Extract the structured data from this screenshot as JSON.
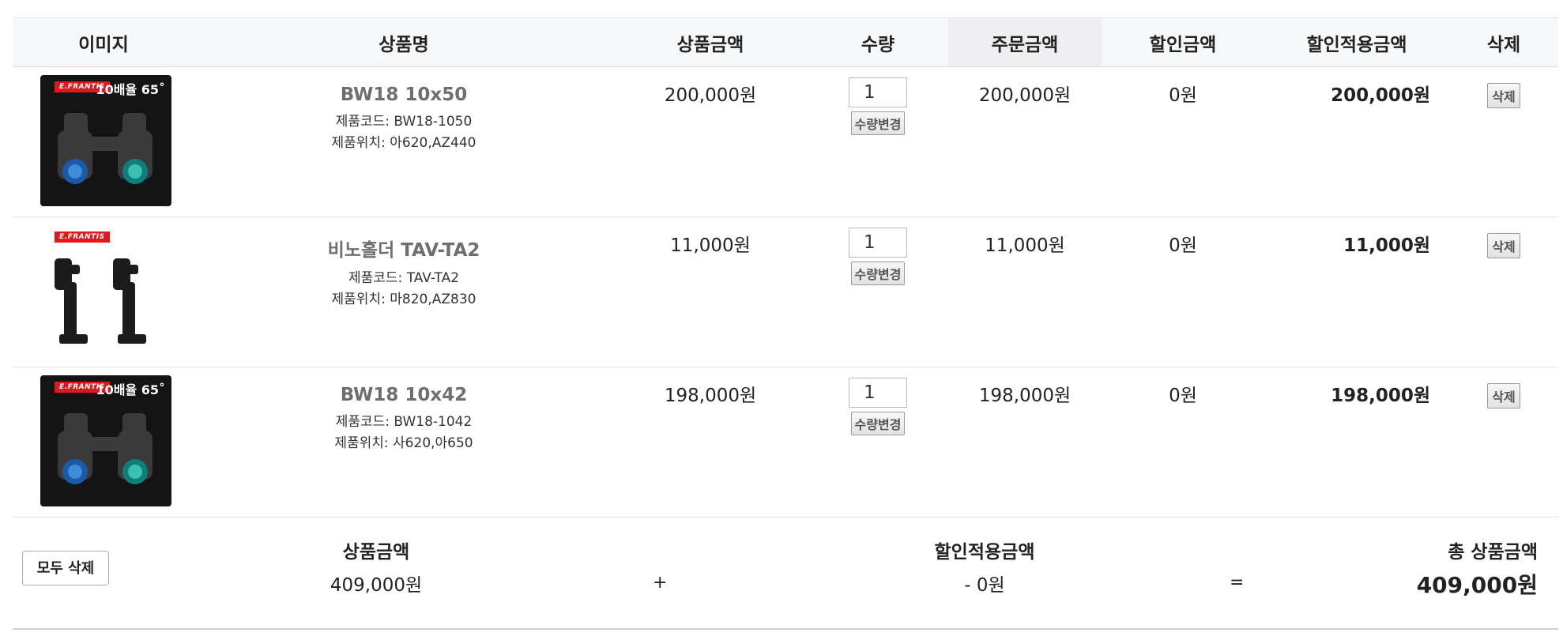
{
  "headers": {
    "image": "이미지",
    "name": "상품명",
    "price": "상품금액",
    "qty": "수량",
    "order": "주문금액",
    "discount": "할인금액",
    "applied": "할인적용금액",
    "delete": "삭제"
  },
  "items": [
    {
      "name": "BW18 10x50",
      "code_label": "제품코드:",
      "code": "BW18-1050",
      "loc_label": "제품위치:",
      "location": "아620,AZ440",
      "price": "200,000원",
      "qty": "1",
      "qty_button": "수량변경",
      "order": "200,000원",
      "discount": "0원",
      "applied": "200,000원",
      "delete_button": "삭제",
      "thumb_brand": "E.FRANTIS",
      "thumb_badge": "10배율 65˚"
    },
    {
      "name": "비노홀더 TAV-TA2",
      "code_label": "제품코드:",
      "code": "TAV-TA2",
      "loc_label": "제품위치:",
      "location": "마820,AZ830",
      "price": "11,000원",
      "qty": "1",
      "qty_button": "수량변경",
      "order": "11,000원",
      "discount": "0원",
      "applied": "11,000원",
      "delete_button": "삭제",
      "thumb_brand": "E.FRANTIS"
    },
    {
      "name": "BW18 10x42",
      "code_label": "제품코드:",
      "code": "BW18-1042",
      "loc_label": "제품위치:",
      "location": "사620,아650",
      "price": "198,000원",
      "qty": "1",
      "qty_button": "수량변경",
      "order": "198,000원",
      "discount": "0원",
      "applied": "198,000원",
      "delete_button": "삭제",
      "thumb_brand": "E.FRANTIS",
      "thumb_badge": "10배율 65˚"
    }
  ],
  "summary": {
    "delete_all": "모두 삭제",
    "subtotal_label": "상품금액",
    "subtotal": "409,000원",
    "plus": "+",
    "discount_label": "할인적용금액",
    "discount": "- 0원",
    "equals": "=",
    "total_label": "총 상품금액",
    "total": "409,000원"
  }
}
